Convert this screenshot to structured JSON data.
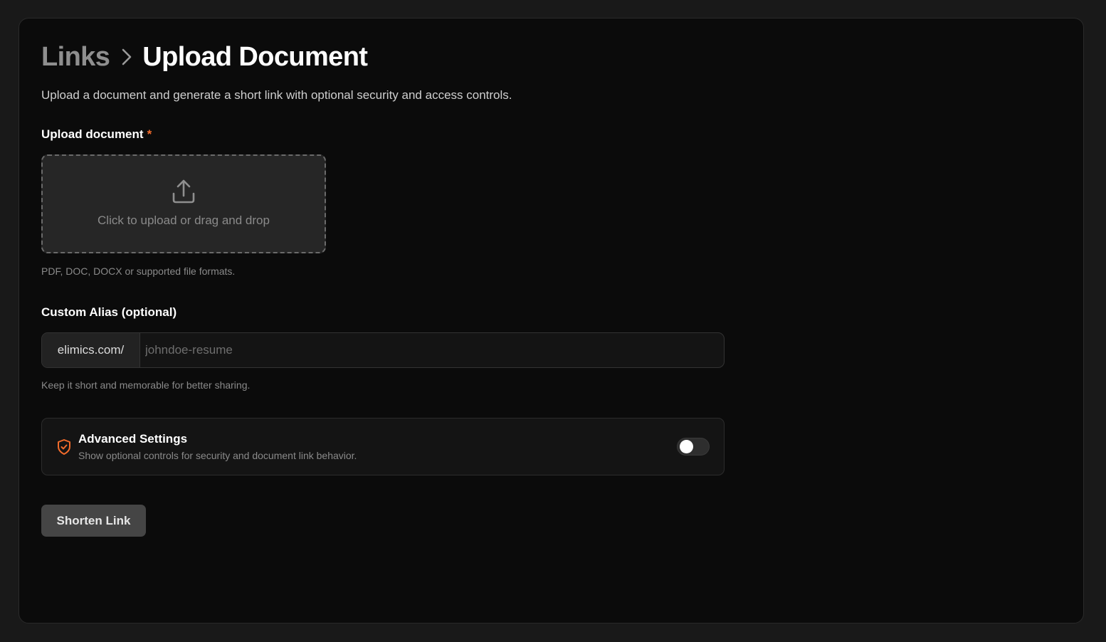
{
  "header": {
    "breadcrumb_root": "Links",
    "breadcrumb_current": "Upload Document",
    "subtitle": "Upload a document and generate a short link with optional security and access controls."
  },
  "upload": {
    "label": "Upload document",
    "required_marker": "*",
    "dropzone_text": "Click to upload or drag and drop",
    "hint": "PDF, DOC, DOCX or supported file formats."
  },
  "alias": {
    "label": "Custom Alias (optional)",
    "prefix": "elimics.com/",
    "value": "",
    "placeholder": "johndoe-resume",
    "hint": "Keep it short and memorable for better sharing."
  },
  "advanced": {
    "title": "Advanced Settings",
    "description": "Show optional controls for security and document link behavior.",
    "enabled": false
  },
  "actions": {
    "submit_label": "Shorten Link"
  },
  "colors": {
    "accent": "#f26b2b",
    "background": "#191919",
    "card": "#0b0b0b"
  },
  "icons": {
    "breadcrumb_separator": "chevron-right-icon",
    "upload": "upload-icon",
    "advanced": "shield-check-icon"
  }
}
